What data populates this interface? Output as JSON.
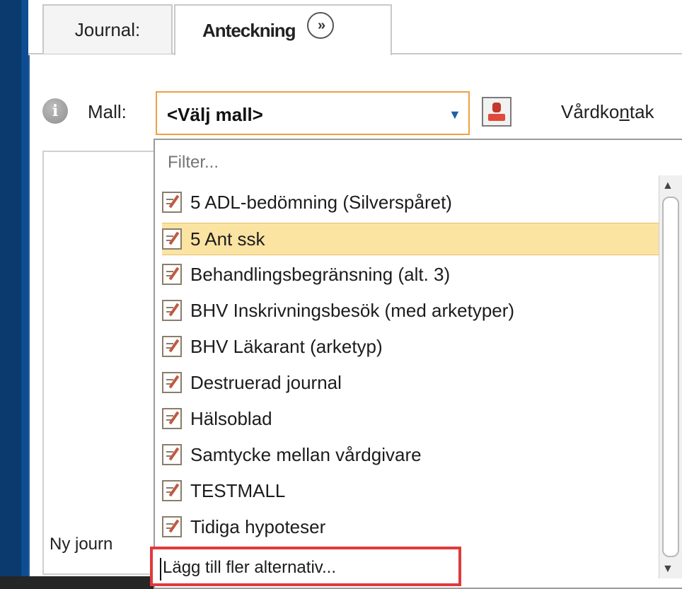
{
  "tabs": {
    "journal": "Journal:",
    "anteckning": "Anteckning",
    "more_glyph": "»"
  },
  "toolbar": {
    "info_glyph": "i",
    "mall_label": "Mall:",
    "select_value": "<Välj mall>",
    "select_arrow": "▼",
    "vardkontakt_pre": "Vårdko",
    "vardkontakt_underlined": "n",
    "vardkontakt_post": "tak"
  },
  "background": {
    "ny_journal": "Ny journ"
  },
  "dropdown": {
    "filter_placeholder": "Filter...",
    "items": [
      {
        "label": "5 ADL-bedömning (Silverspåret)",
        "selected": false
      },
      {
        "label": "5 Ant ssk",
        "selected": true
      },
      {
        "label": "Behandlingsbegränsning (alt. 3)",
        "selected": false
      },
      {
        "label": "BHV Inskrivningsbesök (med arketyper)",
        "selected": false
      },
      {
        "label": "BHV Läkarant (arketyp)",
        "selected": false
      },
      {
        "label": "Destruerad journal",
        "selected": false
      },
      {
        "label": "Hälsoblad",
        "selected": false
      },
      {
        "label": "Samtycke mellan vårdgivare",
        "selected": false
      },
      {
        "label": "TESTMALL",
        "selected": false
      },
      {
        "label": "Tidiga hypoteser",
        "selected": false
      }
    ],
    "add_more": "Lägg till fler alternativ...",
    "scroll_up": "▲",
    "scroll_down": "▼"
  },
  "colors": {
    "frame": "#0b3a6e",
    "select_border": "#f0a040",
    "selected_bg": "#fbe3a2",
    "highlight_box": "#e0393b"
  }
}
